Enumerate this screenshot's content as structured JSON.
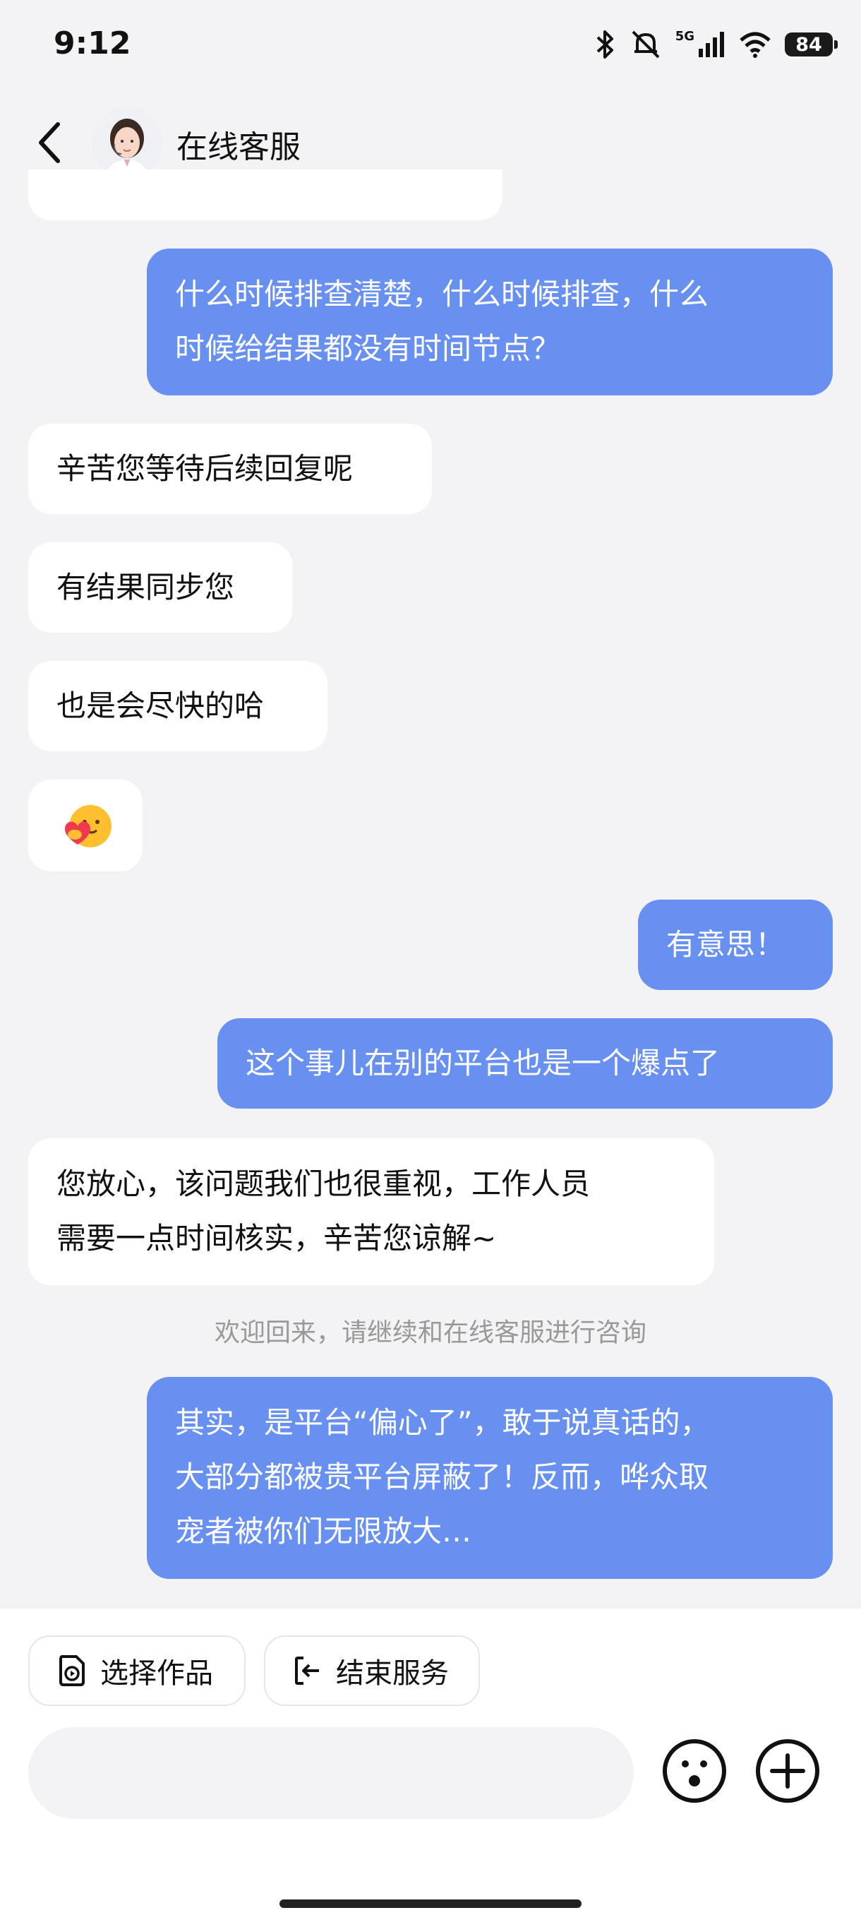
{
  "status_bar": {
    "time": "9:12",
    "battery": "84",
    "network": "5G"
  },
  "header": {
    "title": "在线客服"
  },
  "messages": [
    {
      "side": "right",
      "lines": [
        "什么时候排查清楚，什么时候排查，什么",
        "时候给结果都没有时间节点？"
      ]
    },
    {
      "side": "left",
      "lines": [
        "辛苦您等待后续回复呢"
      ]
    },
    {
      "side": "left",
      "lines": [
        "有结果同步您"
      ]
    },
    {
      "side": "left",
      "lines": [
        "也是会尽快的哈"
      ]
    },
    {
      "side": "left",
      "emoji": "hug-heart-emoji"
    },
    {
      "side": "right",
      "lines": [
        "有意思！"
      ]
    },
    {
      "side": "right",
      "lines": [
        "这个事儿在别的平台也是一个爆点了"
      ]
    },
    {
      "side": "left",
      "lines": [
        "您放心，该问题我们也很重视，工作人员",
        "需要一点时间核实，辛苦您谅解~"
      ]
    },
    {
      "side": "right",
      "lines": [
        "其实，是平台“偏心了”，敢于说真话的，",
        "大部分都被贵平台屏蔽了！反而，哗众取",
        "宠者被你们无限放大…"
      ]
    }
  ],
  "system_notice": "欢迎回来，请继续和在线客服进行咨询",
  "actions": {
    "select_work": "选择作品",
    "end_service": "结束服务"
  },
  "input": {
    "placeholder": ""
  },
  "colors": {
    "user_bubble": "#6790f0",
    "agent_bubble": "#ffffff",
    "background": "#f3f3f5"
  },
  "icons": [
    "back-arrow-icon",
    "bluetooth-icon",
    "mute-bell-icon",
    "signal-icon",
    "wifi-icon",
    "battery-icon",
    "emoji-face-icon",
    "plus-icon",
    "select-work-icon",
    "exit-icon"
  ]
}
